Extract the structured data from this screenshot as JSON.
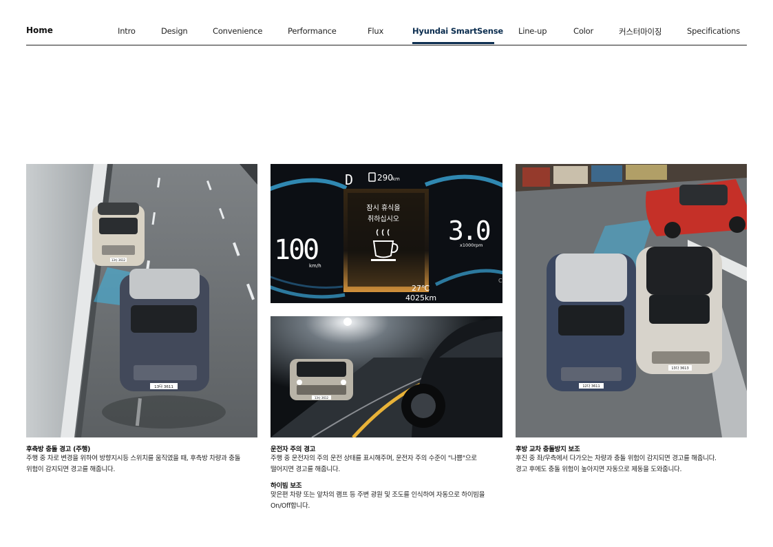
{
  "nav": {
    "home": "Home",
    "items": [
      "Intro",
      "Design",
      "Convenience",
      "Performance",
      "Flux",
      "Hyundai SmartSense",
      "Line-up",
      "Color",
      "커스터마이징",
      "Specifications"
    ],
    "active": "Hyundai SmartSense"
  },
  "cluster": {
    "gear": "D",
    "range": "290",
    "range_unit": "km",
    "message_line1": "잠시 휴식을",
    "message_line2": "취하십시오",
    "speed": "100",
    "speed_unit": "km/h",
    "rpm": "3.0",
    "rpm_unit": "x1000rpm",
    "temp": "27℃",
    "odometer": "4025km",
    "edge_letter": "C"
  },
  "captions": {
    "bca_title": "후측방 충돌 경고 (주행)",
    "bca_line1": "주행 중 차로 변경을 위하여 방향지시등 스위치를 움직였을 때, 후측방 차량과 충돌",
    "bca_line2": "위험이 감지되면 경고를 해줍니다.",
    "daw_title": "운전자 주의 경고",
    "daw_line1": "주행 중 운전자의 주의 운전 상태를 표시해주며, 운전자 주의 수준이 \"나쁨\"으로",
    "daw_line2": "떨어지면 경고를 해줍니다.",
    "hba_title": "하이빔 보조",
    "hba_line1": "맞은편 차량 또는 앞차의 램프 등 주변 광원 및 조도를 인식하여 자동으로 하이빔을",
    "hba_line2": "On/Off합니다.",
    "rcca_title": "후방 교차 충돌방지 보조",
    "rcca_line1": "후진 중 좌/우측에서 다가오는 차량과 충돌 위험이 감지되면 경고를 해줍니다.",
    "rcca_line2": "경고 후에도 충돌 위험이 높아지면 자동으로 제동을 도와줍니다."
  },
  "plates": {
    "car1": "13다 3612",
    "car2": "13다 3611",
    "car3": "13다 3612",
    "car4": "12다 3611",
    "car5": "13다 3613",
    "car6": "12다 3611"
  },
  "colors": {
    "accent": "#0b2d4f",
    "amber": "#e8a040",
    "cluster_blue": "#3aa6d8"
  }
}
